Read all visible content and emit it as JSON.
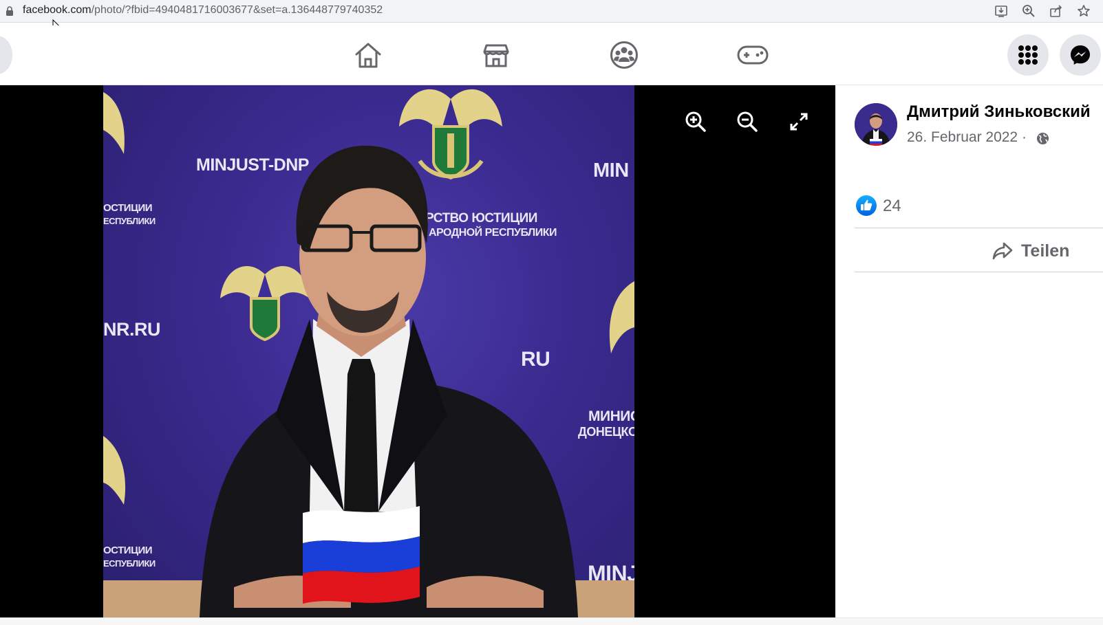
{
  "browser": {
    "url_domain": "facebook.com",
    "url_path": "/photo/?fbid=4940481716003677&set=a.136448779740352",
    "toolbar_icons": [
      "install-app-icon",
      "zoom-icon",
      "share-icon",
      "bookmark-star-icon"
    ]
  },
  "nav": {
    "tabs": [
      "home-icon",
      "marketplace-icon",
      "groups-icon",
      "gaming-icon"
    ],
    "right_buttons": [
      "menu-grid-icon",
      "messenger-icon"
    ]
  },
  "photo": {
    "watermarks": {
      "minjust_dnp": "MINJUST-DNP",
      "min_right": "MIN",
      "ostitsii_left": "ОСТИЦИИ",
      "respubliki_left": "ЕСПУБЛИКИ",
      "ministry_line1": "РСТВО ЮСТИЦИИ",
      "ministry_line2": "АРОДНОЙ РЕСПУБЛИКИ",
      "nr_ru": "NR.RU",
      "ru_mid": "RU",
      "minis": "МИНИС",
      "donetsk": "ДОНЕЦКОЙ",
      "ostitsii_bottom": "ОСТИЦИИ",
      "respubliki_bottom": "ЕСПУБЛИКИ",
      "minj": "MINJ"
    },
    "tools": [
      "zoom-in-icon",
      "zoom-out-icon",
      "fullscreen-icon"
    ]
  },
  "post": {
    "author": "Дмитрий Зиньковский",
    "date": "26. Februar 2022",
    "separator": "·",
    "likes": "24",
    "share_label": "Teilen"
  },
  "colors": {
    "fb_blue": "#1877f2",
    "icon_gray": "#65676b",
    "photo_bg": "#3a2a8e"
  }
}
